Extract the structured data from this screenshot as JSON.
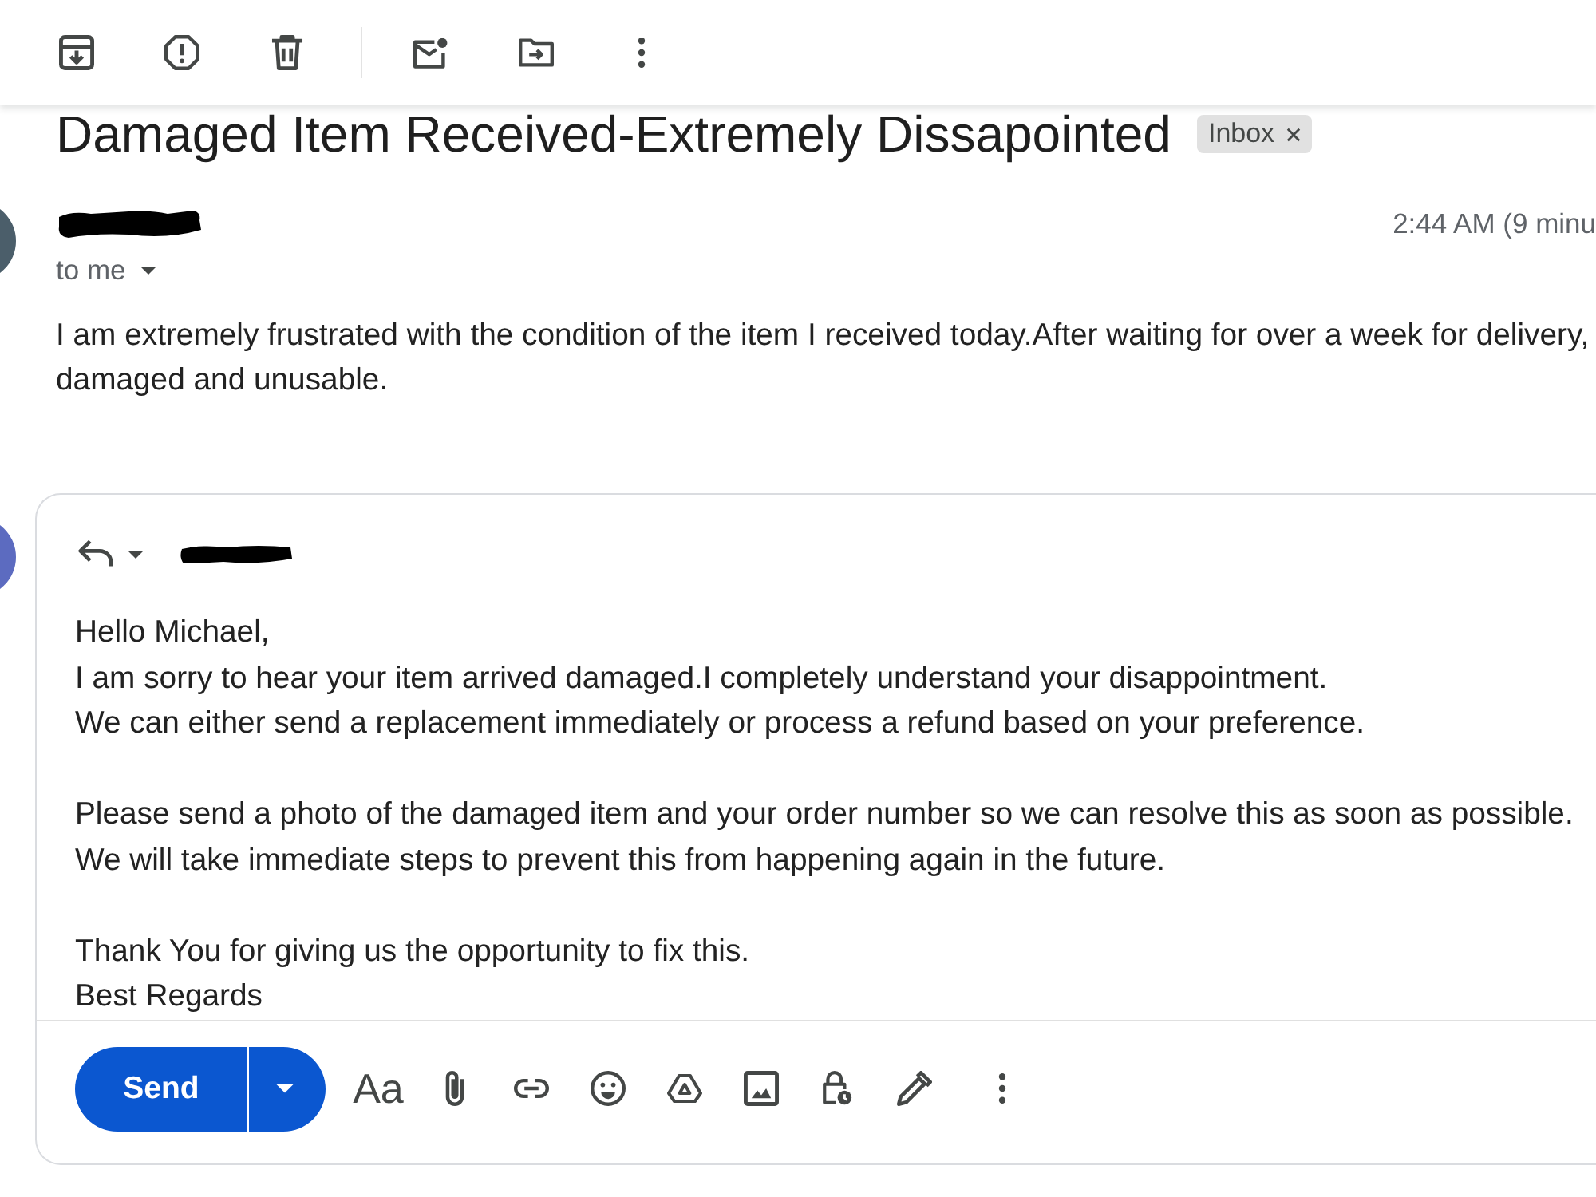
{
  "message": {
    "subject": "Damaged Item Received-Extremely Dissapointed",
    "label": "Inbox",
    "time": "2:44 AM (9 minu",
    "recipient": "to me",
    "body": [
      "I am extremely frustrated with the condition of the item I received today.After waiting for over a week for delivery,",
      "damaged and unusable."
    ]
  },
  "reply": {
    "body": [
      [
        "Hello Michael,",
        "I am sorry to hear your item arrived damaged.I completely understand your disappointment.",
        "We can either send a replacement immediately or process a refund based on your preference."
      ],
      [
        "Please send a photo of the damaged item and your order number so we can resolve this as soon as possible.",
        "We will take immediate steps to prevent this from happening again in the future."
      ],
      [
        "Thank You for giving us the opportunity to fix this.",
        "Best Regards"
      ]
    ],
    "send": "Send",
    "format": "Aa"
  }
}
